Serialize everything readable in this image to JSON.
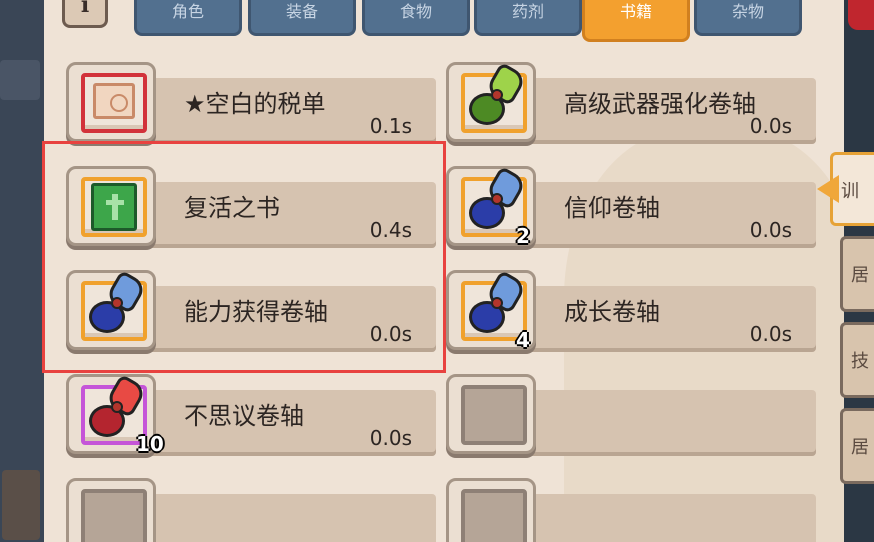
{
  "tabs": [
    {
      "label": "角色",
      "active": false
    },
    {
      "label": "装备",
      "active": false
    },
    {
      "label": "食物",
      "active": false
    },
    {
      "label": "药剂",
      "active": false
    },
    {
      "label": "书籍",
      "active": true
    },
    {
      "label": "杂物",
      "active": false
    }
  ],
  "info_button": "i",
  "side_tabs": [
    "训",
    "居",
    "技",
    "居"
  ],
  "items": [
    {
      "name": "★空白的税单",
      "time": "0.1s",
      "count": "",
      "icon": "ticket-icon",
      "frame": "red"
    },
    {
      "name": "高级武器强化卷轴",
      "time": "0.0s",
      "count": "",
      "icon": "green-scroll-icon",
      "frame": "orange"
    },
    {
      "name": "复活之书",
      "time": "0.4s",
      "count": "",
      "icon": "green-book-icon",
      "frame": "orange"
    },
    {
      "name": "信仰卷轴",
      "time": "0.0s",
      "count": "2",
      "icon": "blue-scroll-icon",
      "frame": "orange"
    },
    {
      "name": "能力获得卷轴",
      "time": "0.0s",
      "count": "",
      "icon": "blue-scroll-icon",
      "frame": "orange"
    },
    {
      "name": "成长卷轴",
      "time": "0.0s",
      "count": "4",
      "icon": "blue-scroll-icon",
      "frame": "orange"
    },
    {
      "name": "不思议卷轴",
      "time": "0.0s",
      "count": "10",
      "icon": "red-scroll-icon",
      "frame": "purple"
    }
  ],
  "colors": {
    "highlight": "#e8423f",
    "tab_active": "#f3a02f",
    "tab_inactive": "#52708f"
  }
}
